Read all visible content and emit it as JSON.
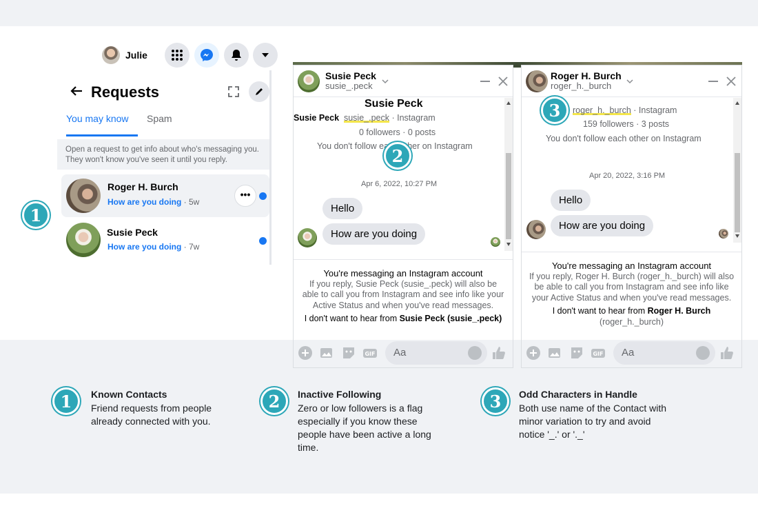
{
  "topnav": {
    "user_name": "Julie"
  },
  "requests": {
    "title": "Requests",
    "tabs": [
      "You may know",
      "Spam"
    ],
    "info": "Open a request to get info about who's messaging you. They won't know you've seen it until you reply.",
    "conversations": [
      {
        "name": "Roger H. Burch",
        "preview": "How are you doing",
        "time": " · 5w",
        "unread": true
      },
      {
        "name": "Susie Peck",
        "preview": "How are you doing",
        "time": " · 7w",
        "unread": true
      }
    ]
  },
  "chat1": {
    "name": "Susie Peck",
    "handle": "susie_.peck",
    "profile_name": "Susie Peck",
    "profile_line_name": "Susie Peck",
    "profile_line_handle": "susie_.peck",
    "profile_line_suffix": " · Instagram",
    "stats": "0 followers · 0 posts",
    "follow_status": "You don't follow each other on Instagram",
    "timestamp": "Apr 6, 2022, 10:27 PM",
    "messages": [
      "Hello",
      "How are you doing"
    ],
    "notice_title": "You're messaging an Instagram account",
    "notice_body": "If you reply, Susie Peck (susie_.peck) will also be able to call you from Instagram and see info like your Active Status and when you've read messages.",
    "opt_out_prefix": "I don't want to hear from ",
    "opt_out_name": "Susie Peck (susie_.peck)",
    "composer_placeholder": "Aa"
  },
  "chat2": {
    "name": "Roger H. Burch",
    "handle": "roger_h._burch",
    "profile_line_handle": "roger_h._burch",
    "profile_line_suffix": " · Instagram",
    "stats": "159 followers · 3 posts",
    "follow_status": "You don't follow each other on Instagram",
    "timestamp": "Apr 20, 2022, 3:16 PM",
    "messages": [
      "Hello",
      "How are you doing"
    ],
    "notice_title": "You're messaging an Instagram account",
    "notice_body": "If you reply, Roger H. Burch (roger_h._burch) will also be able to call you from Instagram and see info like your Active Status and when you've read messages.",
    "opt_out_prefix": "I don't want to hear from ",
    "opt_out_name": "Roger H. Burch",
    "opt_out_handle": "(roger_h._burch)",
    "composer_placeholder": "Aa"
  },
  "badges": [
    "1",
    "2",
    "3"
  ],
  "legend": [
    {
      "title": "Known Contacts",
      "desc": "Friend requests from people already connected with you."
    },
    {
      "title": "Inactive Following",
      "desc": "Zero or low followers is a flag especially if you know these people have been active a long time."
    },
    {
      "title": "Odd Characters in Handle",
      "desc": "Both use name of the Contact with minor variation to try and avoid notice '_.' or '._'"
    }
  ],
  "colors": {
    "accent": "#1877f2",
    "badge": "#2da7b8",
    "bubble": "#e4e6eb"
  }
}
